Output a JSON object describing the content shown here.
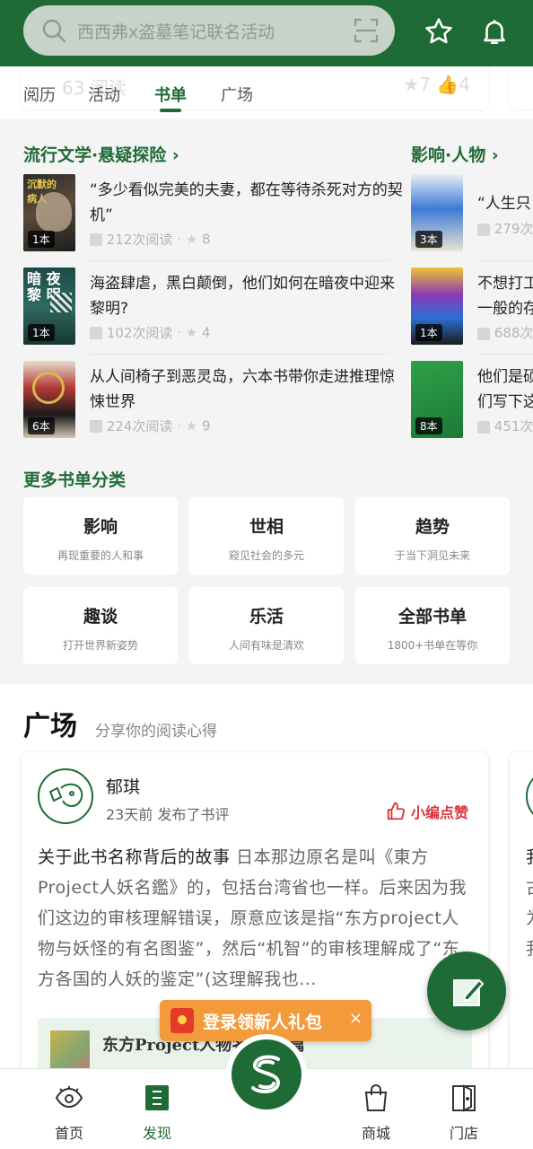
{
  "search": {
    "placeholder": "西西弗x盗墓笔记联名活动"
  },
  "header_icons": [
    "star-icon",
    "bell-icon",
    "scan-icon",
    "search-icon"
  ],
  "ghost_row": {
    "left": "63 ",
    "left_tail": "阅读",
    "star": "7",
    "thumb": "4"
  },
  "tabs": [
    {
      "label": "阅历",
      "active": false
    },
    {
      "label": "活动",
      "active": false
    },
    {
      "label": "书单",
      "active": true
    },
    {
      "label": "广场",
      "active": false
    }
  ],
  "booklists": {
    "group1": {
      "title": "流行文学·悬疑探险",
      "items": [
        {
          "title": "“多少看似完美的夫妻，都在等待杀死对方的契机”",
          "count": "1本",
          "reads": "212次阅读",
          "stars": "8"
        },
        {
          "title": "海盗肆虐，黑白颠倒，他们如何在暗夜中迎来黎明?",
          "count": "1本",
          "reads": "102次阅读",
          "stars": "4"
        },
        {
          "title": "从人间椅子到恶灵岛，六本书带你走进推理惊悚世界",
          "count": "6本",
          "reads": "224次阅读",
          "stars": "9"
        }
      ]
    },
    "group2": {
      "title": "影响·人物",
      "items": [
        {
          "title": "“人生只",
          "count": "3本",
          "reads": "279次"
        },
        {
          "title": "不想打工",
          "title2": "一般的存",
          "count": "1本",
          "reads": "688次"
        },
        {
          "title": "他们是硕",
          "title2": "们写下这",
          "count": "8本",
          "reads": "451次"
        }
      ]
    }
  },
  "more_categories": {
    "title": "更多书单分类",
    "items": [
      {
        "name": "影响",
        "desc": "再现重要的人和事"
      },
      {
        "name": "世相",
        "desc": "窥见社会的多元"
      },
      {
        "name": "趋势",
        "desc": "于当下洞见未来"
      },
      {
        "name": "趣谈",
        "desc": "打开世界新姿势"
      },
      {
        "name": "乐活",
        "desc": "人间有味是清欢"
      },
      {
        "name": "全部书单",
        "desc": "1800+书单在等你"
      }
    ]
  },
  "plaza": {
    "title": "广场",
    "subtitle": "分享你的阅读心得",
    "card": {
      "user": "郁琪",
      "time": "23天前 发布了书评",
      "badge": "小编点赞",
      "review_title": "关于此书名称背后的故事",
      "review_body": "日本那边原名是叫《東方Project人妖名鑑》的，包括台湾省也一样。后来因为我们这边的审核理解错误，原意应该是指“东方project人物与妖怪的有名图鉴”，然后“机智”的审核理解成了“东方各国的人妖的鉴定”(这理解我也...",
      "book_title": "东方Project人物名鉴†暗篇"
    },
    "card2_peek": [
      "我",
      "古",
      "为",
      "我"
    ]
  },
  "promo": {
    "text": "登录领新人礼包",
    "close": "×"
  },
  "nav": [
    {
      "label": "首页",
      "icon": "eye-icon",
      "active": false
    },
    {
      "label": "发现",
      "icon": "discover-icon",
      "active": true
    },
    {
      "label": "",
      "icon": "sisyphe-logo-icon",
      "active": false
    },
    {
      "label": "商城",
      "icon": "shopping-bag-icon",
      "active": false
    },
    {
      "label": "门店",
      "icon": "store-door-icon",
      "active": false
    }
  ],
  "colors": {
    "brand_green": "#1f6b35",
    "accent_red": "#d8343a",
    "promo_orange": "#f39a3a"
  }
}
